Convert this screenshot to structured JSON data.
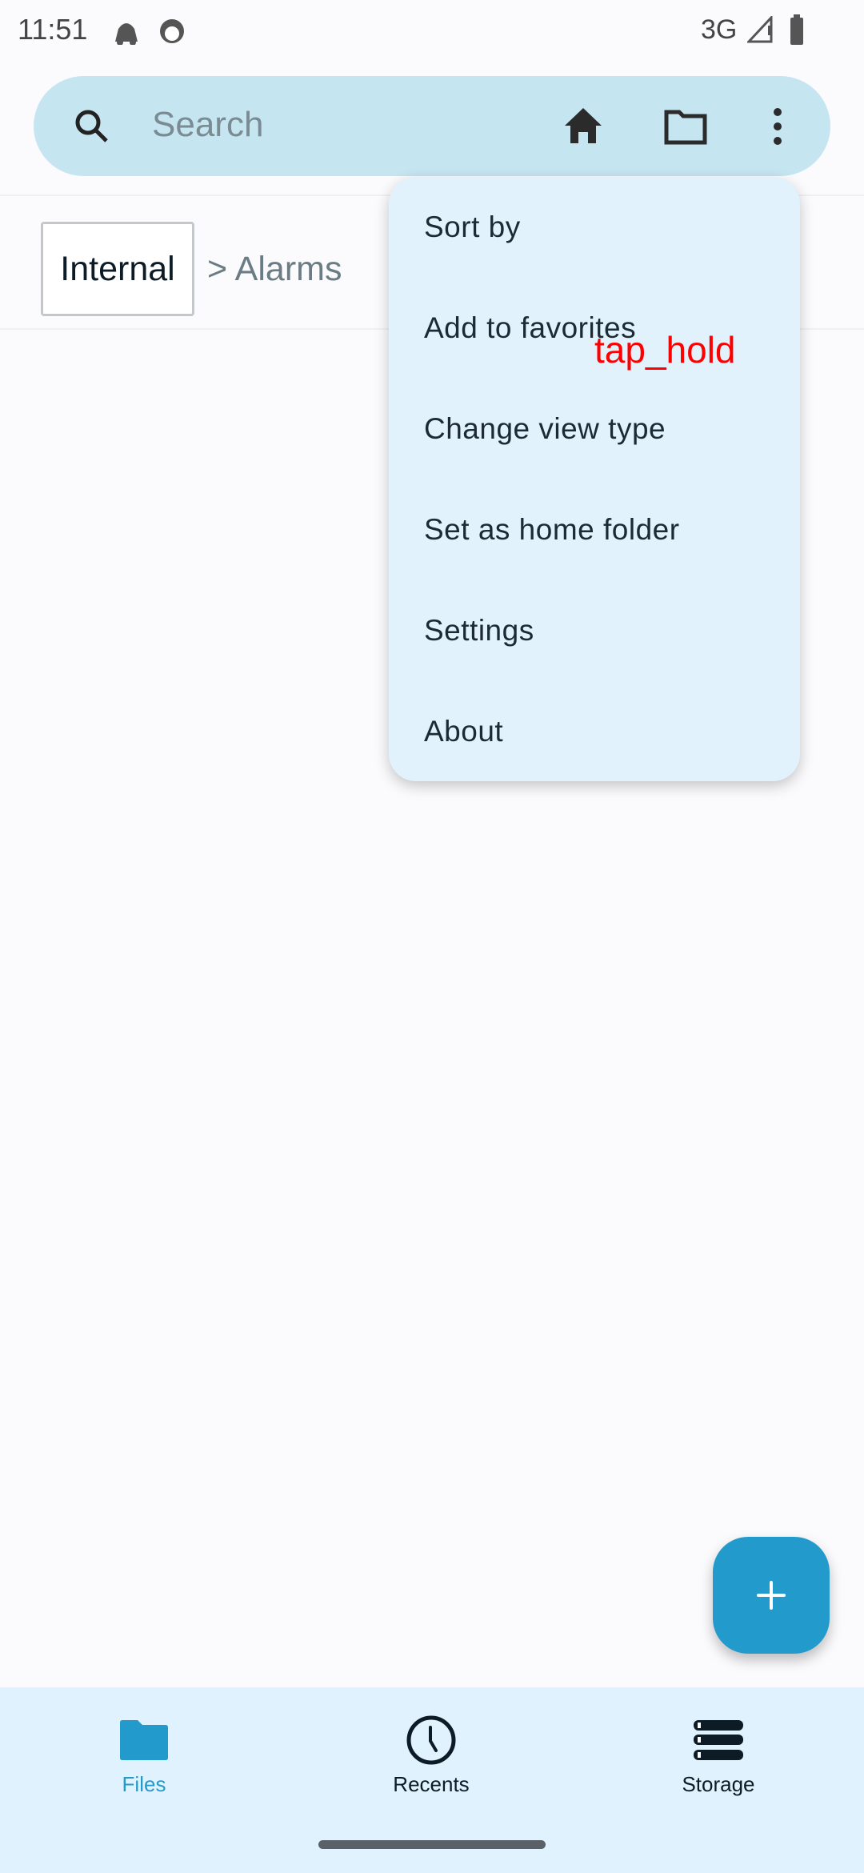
{
  "status_bar": {
    "time": "11:51",
    "network": "3G"
  },
  "search": {
    "placeholder": "Search"
  },
  "breadcrumb": {
    "root": "Internal",
    "path": "> Alarms"
  },
  "menu": {
    "items": [
      {
        "label": "Sort by"
      },
      {
        "label": "Add to favorites"
      },
      {
        "label": "Change view type"
      },
      {
        "label": "Set as home folder"
      },
      {
        "label": "Settings"
      },
      {
        "label": "About"
      }
    ]
  },
  "overlay": {
    "annotation": "tap_hold"
  },
  "bottom_nav": {
    "items": [
      {
        "label": "Files",
        "active": true
      },
      {
        "label": "Recents"
      },
      {
        "label": "Storage"
      }
    ]
  },
  "colors": {
    "accent": "#229bcc",
    "search_bg": "#c5e5f1",
    "menu_bg": "#e1f2fd",
    "nav_bg": "#e0f2fd"
  }
}
